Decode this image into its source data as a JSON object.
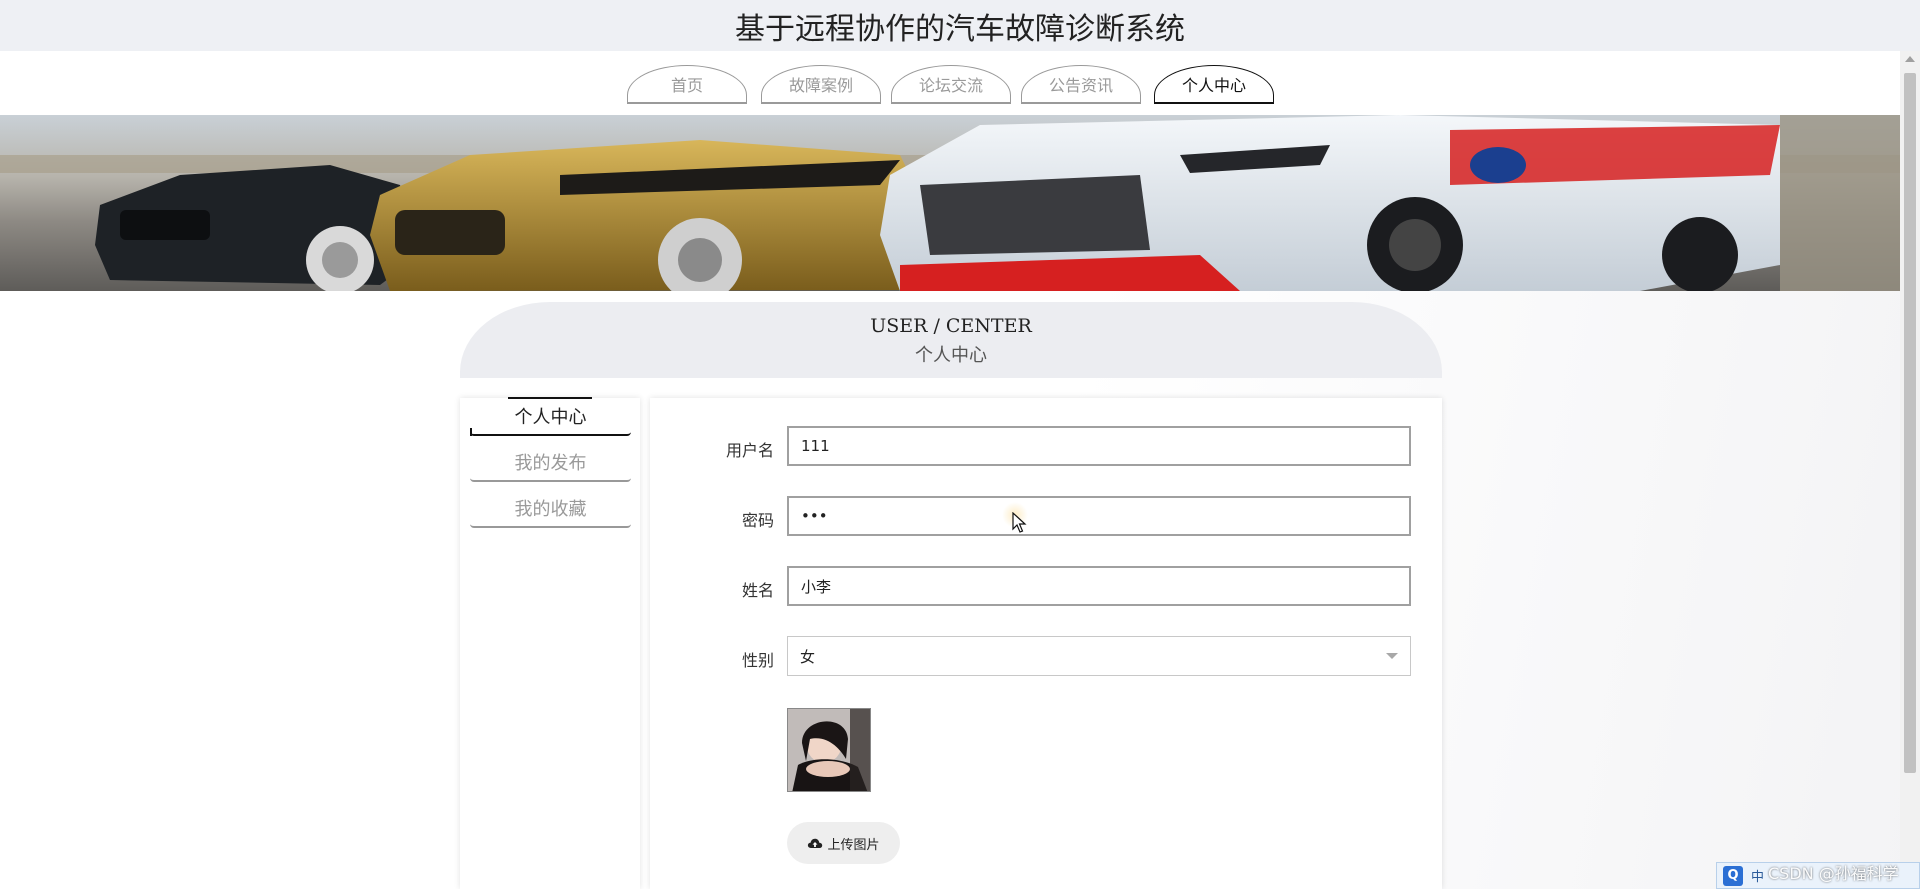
{
  "site": {
    "title": "基于远程协作的汽车故障诊断系统"
  },
  "nav": {
    "items": [
      {
        "label": "首页",
        "active": false
      },
      {
        "label": "故障案例",
        "active": false
      },
      {
        "label": "论坛交流",
        "active": false
      },
      {
        "label": "公告资讯",
        "active": false
      },
      {
        "label": "个人中心",
        "active": true
      }
    ]
  },
  "section": {
    "title_en": "USER / CENTER",
    "title_cn": "个人中心"
  },
  "sidebar": {
    "items": [
      {
        "label": "个人中心",
        "active": true
      },
      {
        "label": "我的发布",
        "active": false
      },
      {
        "label": "我的收藏",
        "active": false
      }
    ]
  },
  "form": {
    "username": {
      "label": "用户名",
      "value": "111"
    },
    "password": {
      "label": "密码",
      "value": "•••"
    },
    "name": {
      "label": "姓名",
      "value": "小李"
    },
    "gender": {
      "label": "性别",
      "value": "女"
    },
    "upload_label": "上传图片"
  },
  "ime": {
    "logo": "Q",
    "mode": "中"
  },
  "watermark": "CSDN @孙福科学",
  "colors": {
    "header_bg": "#eef0f4",
    "active": "#111111",
    "inactive": "#9a9a9a",
    "ime_blue": "#2b6fd4"
  }
}
